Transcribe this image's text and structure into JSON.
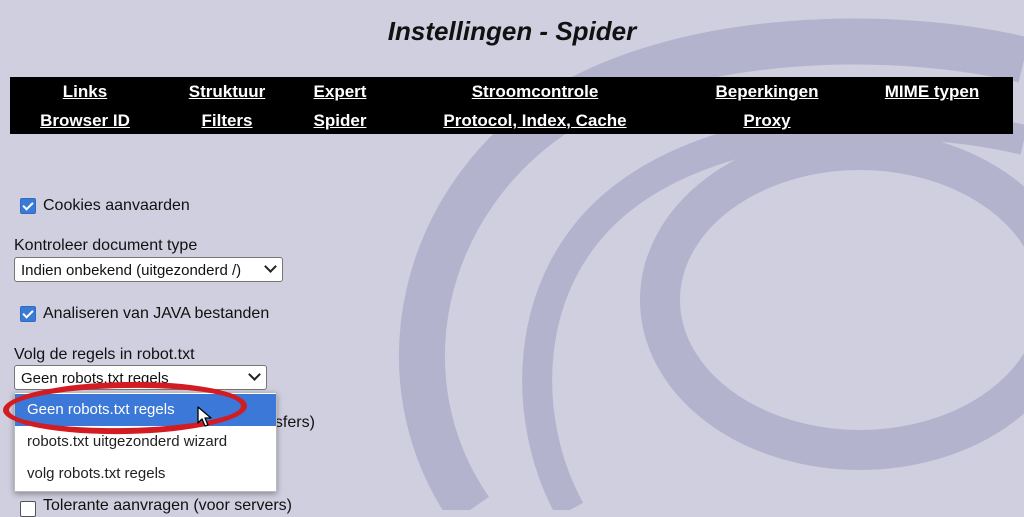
{
  "page": {
    "title": "Instellingen - Spider"
  },
  "nav": {
    "row1": [
      "Links",
      "Struktuur",
      "Expert",
      "Stroomcontrole",
      "Beperkingen",
      "MIME typen"
    ],
    "row2": [
      "Browser ID",
      "Filters",
      "Spider",
      "Protocol, Index, Cache",
      "Proxy"
    ]
  },
  "options": {
    "cookies": {
      "label": "Cookies aanvaarden",
      "checked": true
    },
    "doctype": {
      "label": "Kontroleer document type",
      "selected": "Indien onbekend (uitgezonderd /)"
    },
    "java": {
      "label": "Analiseren van JAVA bestanden",
      "checked": true
    },
    "robots": {
      "label": "Volg de regels in robot.txt",
      "selected": "Geen robots.txt regels",
      "options": [
        "Geen robots.txt regels",
        "robots.txt uitgezonderd wizard",
        "volg robots.txt regels"
      ]
    },
    "partial_label": "nsfers)",
    "tolerant": {
      "label": "Tolerante aanvragen (voor servers)",
      "checked": false
    }
  },
  "colors": {
    "accent": "#3b78d8",
    "highlight": "#d21c22",
    "nav_bg": "#000000",
    "page_bg": "#cfcfe0"
  }
}
